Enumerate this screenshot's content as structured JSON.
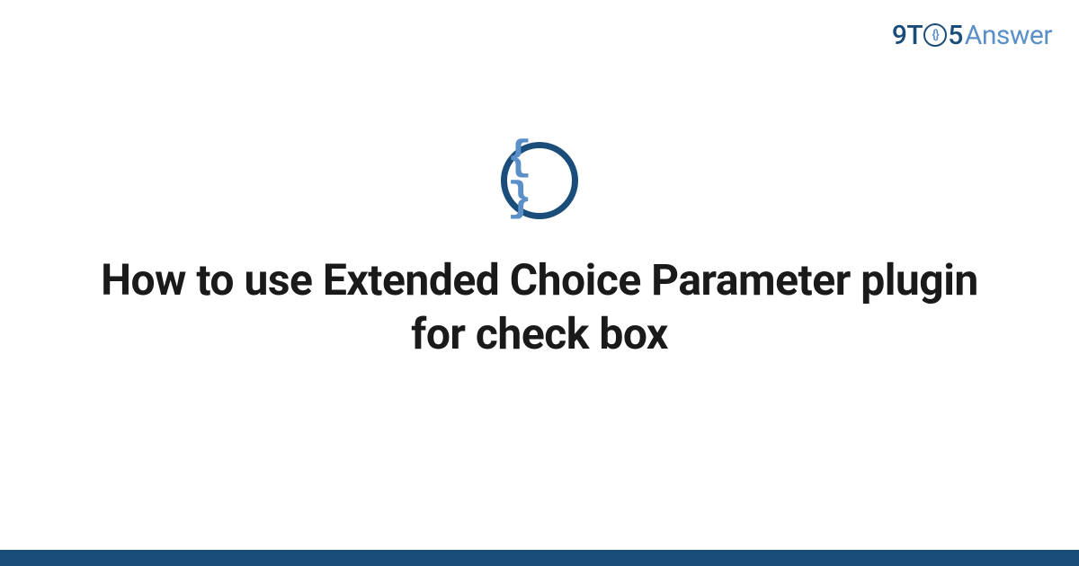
{
  "brand": {
    "part1": "9T",
    "circle_inner": "{}",
    "part2": "5",
    "part3": "Answer"
  },
  "icon": {
    "symbol": "{ }"
  },
  "title": "How to use Extended Choice Parameter plugin for check box",
  "colors": {
    "primary": "#1a4d7a",
    "secondary": "#5b8fc7",
    "text": "#1a1a1a",
    "background": "#ffffff"
  }
}
